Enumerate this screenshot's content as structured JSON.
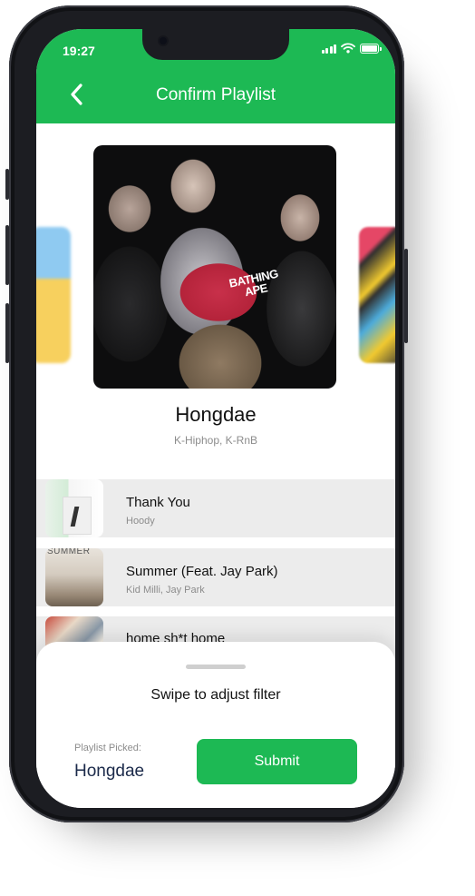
{
  "status_bar": {
    "time": "19:27"
  },
  "header": {
    "title": "Confirm Playlist",
    "accent": "#1db954"
  },
  "playlist": {
    "name": "Hongdae",
    "genres": "K-Hiphop, K-RnB",
    "cover_cap_text": "BATHING APE"
  },
  "tracks": [
    {
      "title": "Thank You",
      "artist": "Hoody"
    },
    {
      "title": "Summer (Feat. Jay Park)",
      "artist": "Kid Milli, Jay Park",
      "thumb_text": "SUMMER"
    },
    {
      "title": "home sh*t home",
      "artist": ""
    }
  ],
  "sheet": {
    "hint": "Swipe to adjust filter",
    "picked_label": "Playlist Picked:",
    "picked_value": "Hongdae",
    "submit_label": "Submit"
  },
  "icons": [
    "back-chevron-icon",
    "signal-icon",
    "wifi-icon",
    "battery-icon"
  ]
}
